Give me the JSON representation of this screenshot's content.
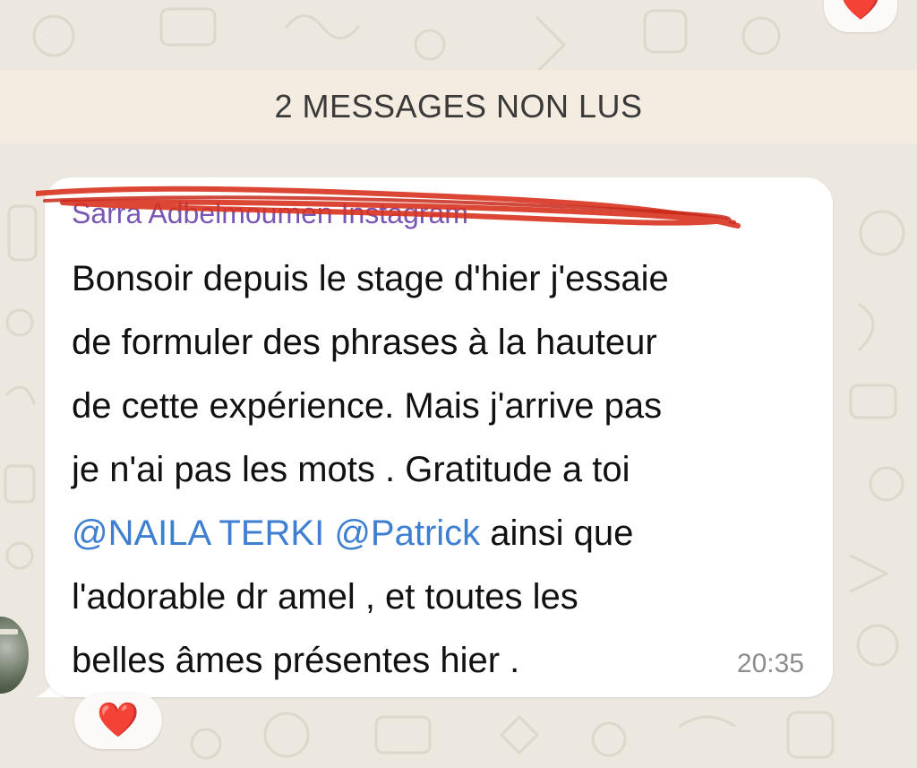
{
  "chat": {
    "unread_banner": "2 MESSAGES NON LUS",
    "top_reaction": "❤️",
    "message": {
      "sender": "Sarra Adbelmoumen Instagram",
      "line1": "Bonsoir depuis le stage d'hier j'essaie",
      "line2": "de formuler des phrases à la hauteur",
      "line3": "de cette expérience.  Mais j'arrive pas",
      "line4": "je n'ai pas les mots . Gratitude a toi",
      "mention1": "@NAILA TERKI",
      "mention2": "@Patrick",
      "line5_rest": "ainsi que",
      "line6": "l'adorable dr amel , et toutes les",
      "line7": "belles âmes présentes hier .",
      "time": "20:35",
      "reaction": "❤️"
    }
  },
  "colors": {
    "background": "#ece7df",
    "banner": "#f4ece1",
    "bubble": "#ffffff",
    "mention": "#3e7fd1",
    "sender": "#7a56b4",
    "scribble": "#d8321e"
  },
  "icons": {
    "reaction": "heart-icon"
  }
}
